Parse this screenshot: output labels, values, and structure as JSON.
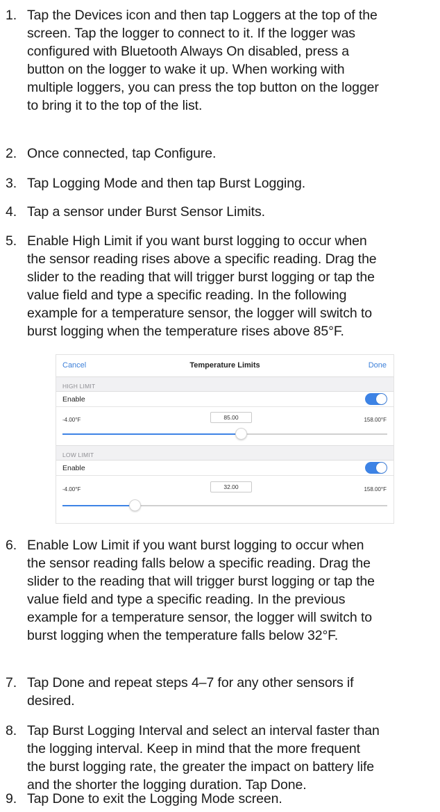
{
  "steps": [
    {
      "num": "1.",
      "lines": [
        "Tap the Devices icon and then tap Loggers at the top of the",
        "screen. Tap the logger to connect to it. If the logger was",
        "configured with Bluetooth Always On disabled, press a",
        "button on the logger to wake it up. When working with",
        "multiple loggers, you can press the top button on the logger",
        "to bring it to the top of the list."
      ]
    },
    {
      "num": "2.",
      "lines": [
        "Once connected, tap Configure."
      ]
    },
    {
      "num": "3.",
      "lines": [
        "Tap Logging Mode and then tap Burst Logging."
      ]
    },
    {
      "num": "4.",
      "lines": [
        "Tap a sensor under Burst Sensor Limits."
      ]
    },
    {
      "num": "5.",
      "lines": [
        "Enable High Limit if you want burst logging to occur when",
        "the sensor reading rises above a specific reading. Drag the",
        "slider to the reading that will trigger burst logging or tap the",
        "value field and type a specific reading. In the following",
        "example for a temperature sensor, the logger will switch to",
        "burst logging when the temperature rises above 85°F."
      ]
    },
    {
      "num": "6.",
      "lines": [
        "Enable Low Limit if you want burst logging to occur when",
        "the sensor reading falls below a specific reading. Drag the",
        "slider to the reading that will trigger burst logging or tap the",
        "value field and type a specific reading. In the previous",
        "example for a temperature sensor, the logger will switch to",
        "burst logging when the temperature falls below 32°F."
      ]
    },
    {
      "num": "7.",
      "lines": [
        "Tap Done and repeat steps 4–7 for any other sensors if",
        "desired."
      ]
    },
    {
      "num": "8.",
      "lines": [
        "Tap Burst Logging Interval and select an interval faster than",
        "the logging interval. Keep in mind that the more frequent",
        "the burst logging rate, the greater the impact on battery life",
        "and the shorter the logging duration. Tap Done."
      ]
    },
    {
      "num": "9.",
      "lines": [
        "Tap Done to exit the Logging Mode screen."
      ]
    }
  ],
  "screenshot": {
    "nav": {
      "cancel": "Cancel",
      "title": "Temperature Limits",
      "done": "Done"
    },
    "high": {
      "header": "HIGH LIMIT",
      "enable_label": "Enable",
      "enabled": true,
      "min": "-4.00°F",
      "max": "158.00°F",
      "value": "85.00",
      "fraction": 0.55
    },
    "low": {
      "header": "LOW LIMIT",
      "enable_label": "Enable",
      "enabled": true,
      "min": "-4.00°F",
      "max": "158.00°F",
      "value": "32.00",
      "fraction": 0.222
    },
    "accent_color": "#3d83e5"
  }
}
